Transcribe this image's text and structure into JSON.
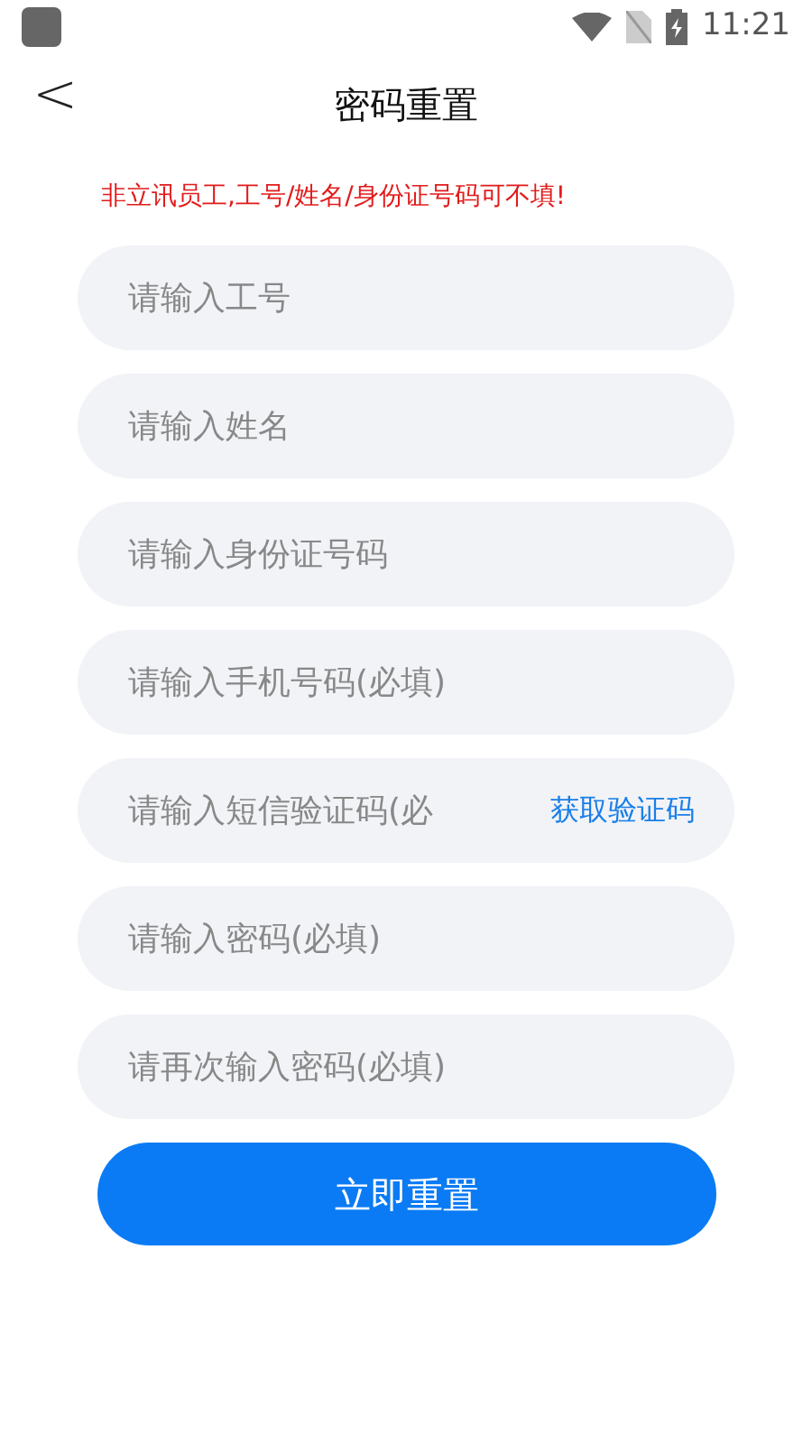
{
  "status_bar": {
    "time": "11:21"
  },
  "header": {
    "back": "<",
    "title": "密码重置"
  },
  "notice": "非立讯员工,工号/姓名/身份证号码可不填!",
  "fields": [
    {
      "kind": "text",
      "placeholder": "请输入工号"
    },
    {
      "kind": "text",
      "placeholder": "请输入姓名"
    },
    {
      "kind": "text",
      "placeholder": "请输入身份证号码"
    },
    {
      "kind": "text",
      "placeholder": "请输入手机号码(必填)"
    },
    {
      "kind": "code",
      "placeholder": "请输入短信验证码(必",
      "action": "获取验证码"
    },
    {
      "kind": "password",
      "placeholder": "请输入密码(必填)"
    },
    {
      "kind": "password",
      "placeholder": "请再次输入密码(必填)"
    }
  ],
  "submit": "立即重置"
}
